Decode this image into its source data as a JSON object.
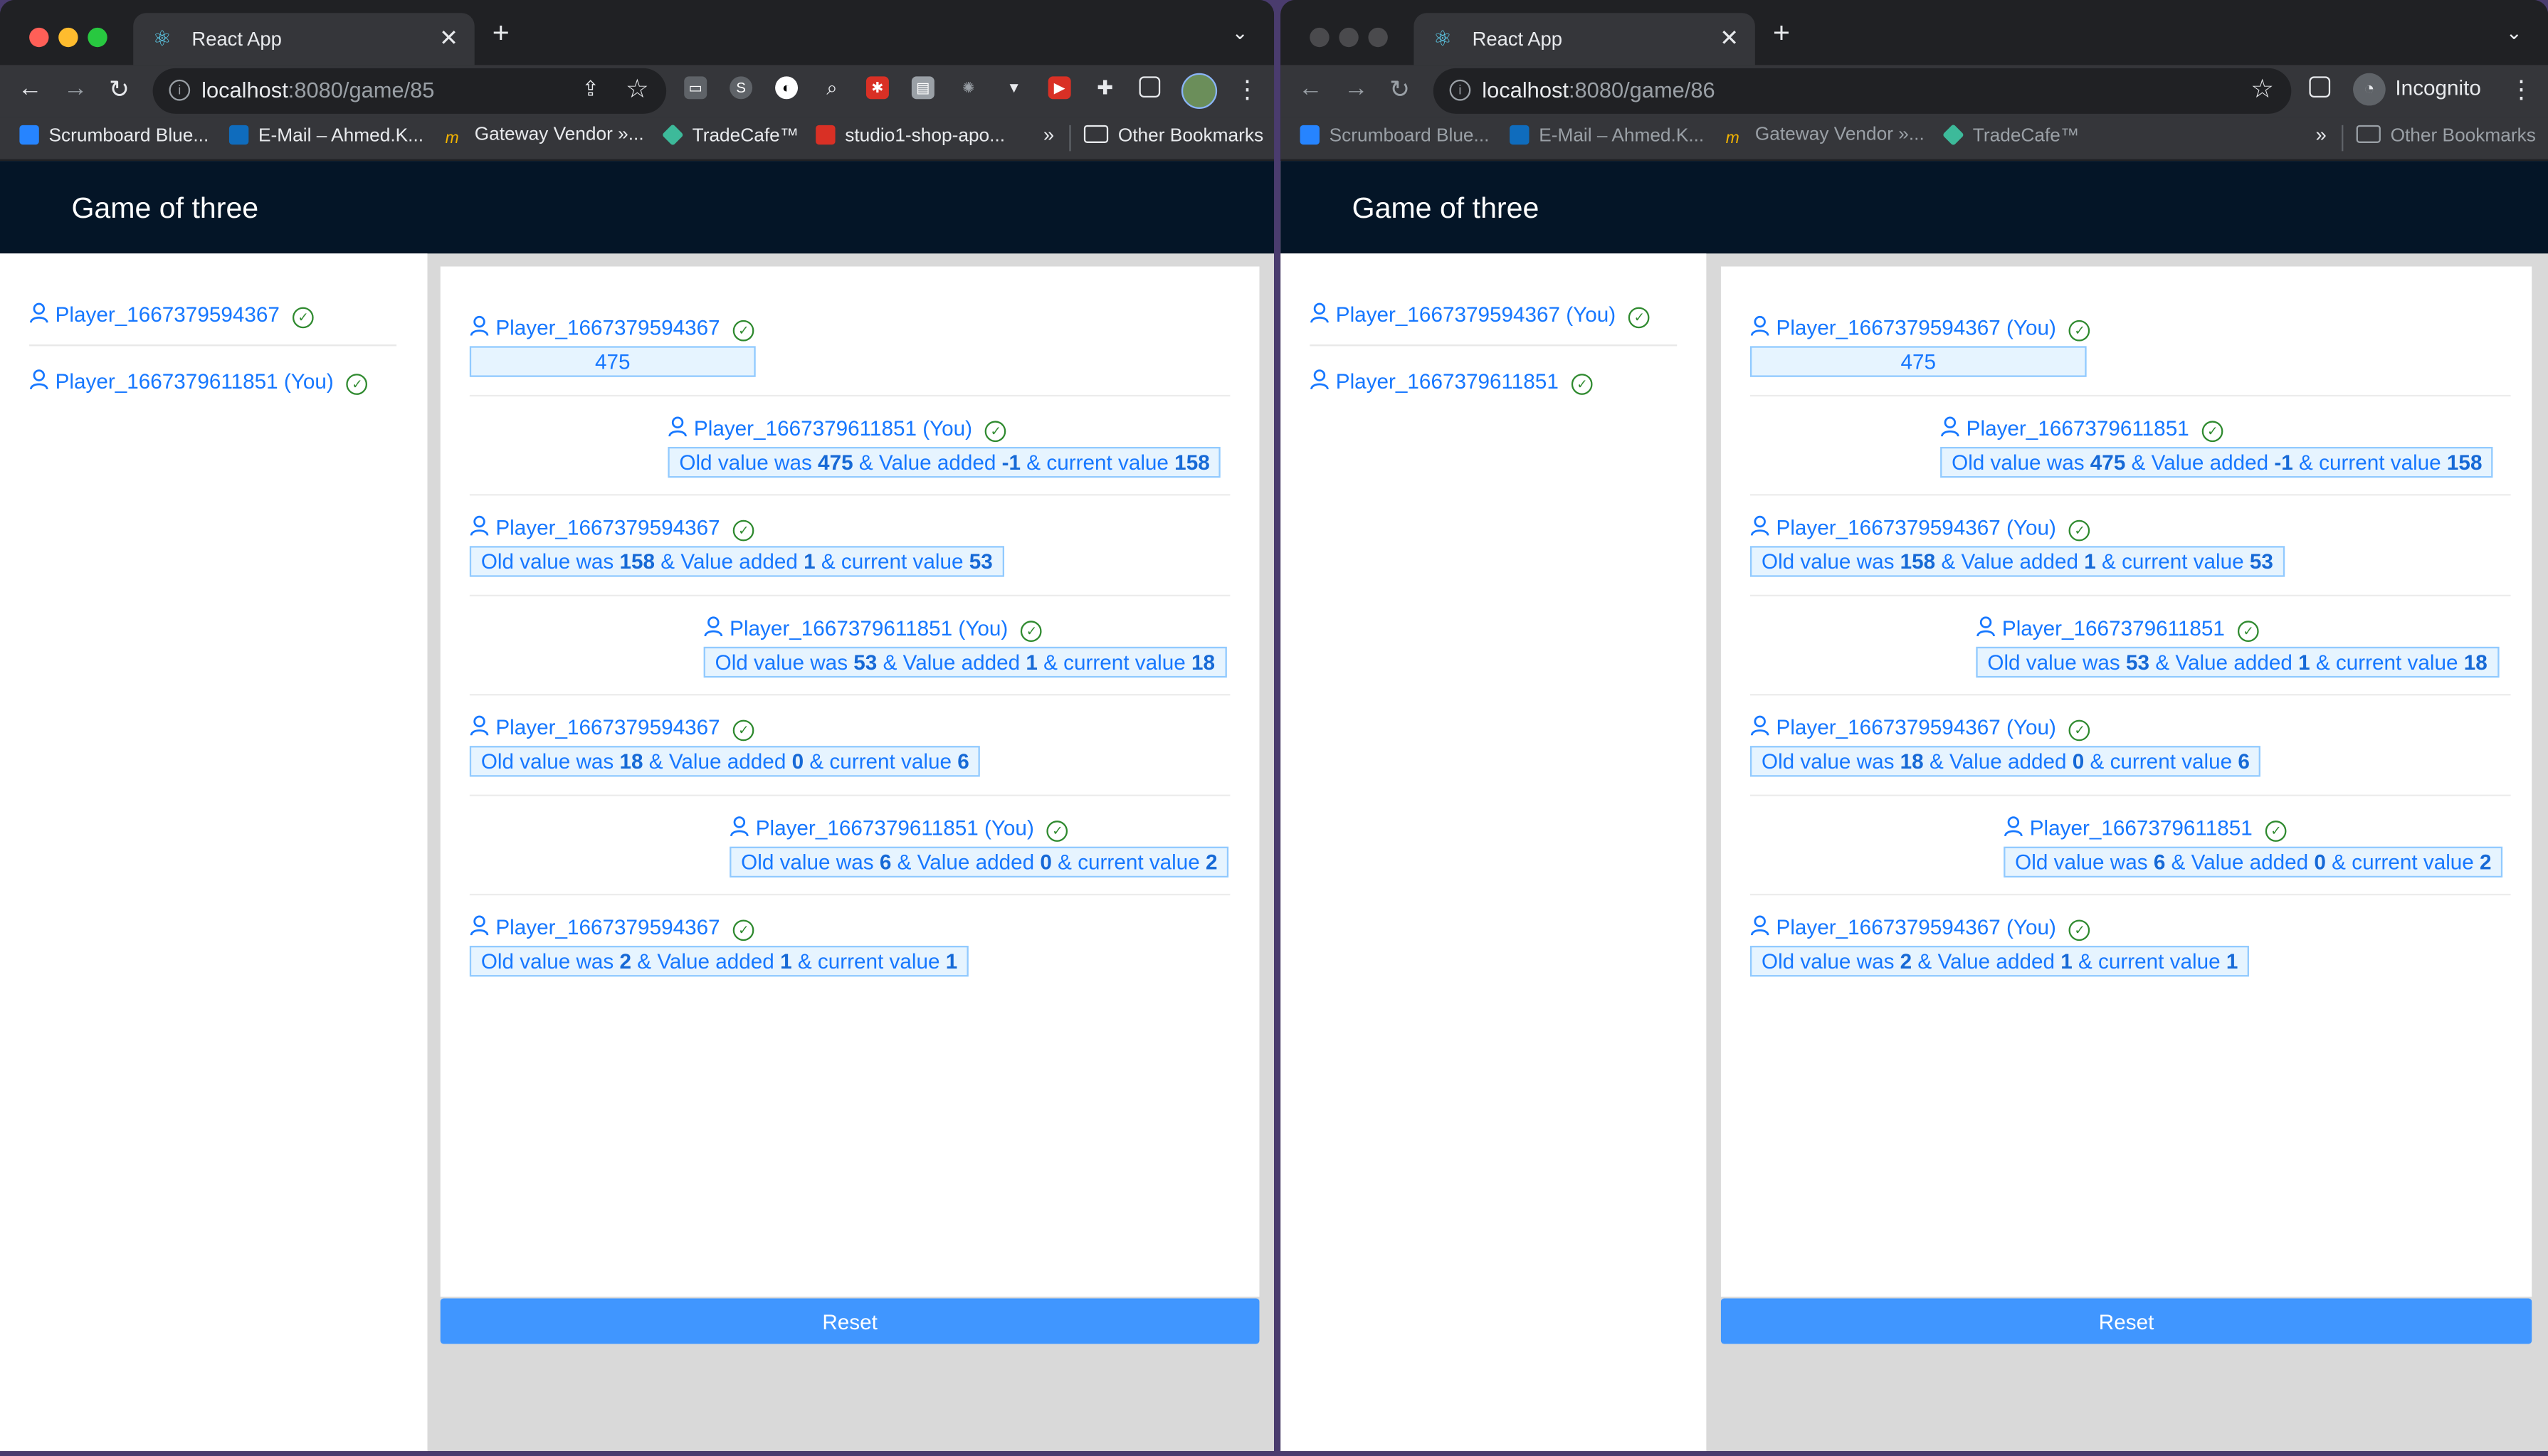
{
  "windows": [
    {
      "tab_title": "React App",
      "url_host": "localhost",
      "url_path": ":8080/game/85",
      "bookmarks": [
        "Scrumboard Blue...",
        "E-Mail – Ahmed.K...",
        "Gateway Vendor »...",
        "TradeCafe™",
        "studio1-shop-apo..."
      ],
      "other_bookmarks": "Other Bookmarks",
      "app_title": "Game of three",
      "players": [
        "Player_1667379594367",
        "Player_1667379611851 (You)"
      ],
      "moves": [
        {
          "player": "Player_1667379594367",
          "start": "475"
        },
        {
          "player": "Player_1667379611851 (You)",
          "old": "475",
          "added": "-1",
          "current": "158"
        },
        {
          "player": "Player_1667379594367",
          "old": "158",
          "added": "1",
          "current": "53"
        },
        {
          "player": "Player_1667379611851 (You)",
          "old": "53",
          "added": "1",
          "current": "18"
        },
        {
          "player": "Player_1667379594367",
          "old": "18",
          "added": "0",
          "current": "6"
        },
        {
          "player": "Player_1667379611851 (You)",
          "old": "6",
          "added": "0",
          "current": "2"
        },
        {
          "player": "Player_1667379594367",
          "old": "2",
          "added": "1",
          "current": "1"
        }
      ],
      "reset_label": "Reset"
    },
    {
      "tab_title": "React App",
      "url_host": "localhost",
      "url_path": ":8080/game/86",
      "incognito_label": "Incognito",
      "bookmarks": [
        "Scrumboard Blue...",
        "E-Mail – Ahmed.K...",
        "Gateway Vendor »...",
        "TradeCafe™"
      ],
      "other_bookmarks": "Other Bookmarks",
      "app_title": "Game of three",
      "players": [
        "Player_1667379594367 (You)",
        "Player_1667379611851"
      ],
      "moves": [
        {
          "player": "Player_1667379594367 (You)",
          "start": "475"
        },
        {
          "player": "Player_1667379611851",
          "old": "475",
          "added": "-1",
          "current": "158"
        },
        {
          "player": "Player_1667379594367 (You)",
          "old": "158",
          "added": "1",
          "current": "53"
        },
        {
          "player": "Player_1667379611851",
          "old": "53",
          "added": "1",
          "current": "18"
        },
        {
          "player": "Player_1667379594367 (You)",
          "old": "18",
          "added": "0",
          "current": "6"
        },
        {
          "player": "Player_1667379611851",
          "old": "6",
          "added": "0",
          "current": "2"
        },
        {
          "player": "Player_1667379594367 (You)",
          "old": "2",
          "added": "1",
          "current": "1"
        }
      ],
      "reset_label": "Reset"
    }
  ],
  "msg_text": {
    "old": "Old value was ",
    "added": " & Value added ",
    "current": " & current value "
  },
  "colors": {
    "header_bg": "#041527",
    "player_link": "#1677ff",
    "check_green": "#2f8a2f",
    "reset_bg": "#4096ff",
    "message_bg": "#e6f4ff"
  },
  "icons": {
    "player": "user-icon",
    "status": "check-circle-icon",
    "tab_favicon": "react-icon"
  }
}
